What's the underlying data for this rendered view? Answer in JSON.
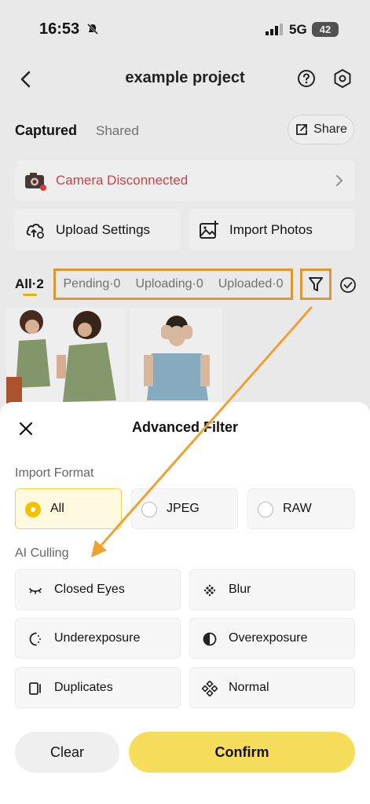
{
  "status_bar": {
    "time": "16:53",
    "network": "5G",
    "battery": "42"
  },
  "nav": {
    "title": "example project"
  },
  "tabs": {
    "captured": "Captured",
    "shared": "Shared",
    "share_button": "Share"
  },
  "camera": {
    "status": "Camera Disconnected"
  },
  "actions": {
    "upload_settings": "Upload Settings",
    "import_photos": "Import Photos"
  },
  "filter_row": {
    "all": "All·2",
    "pending": "Pending·0",
    "uploading": "Uploading·0",
    "uploaded": "Uploaded·0"
  },
  "sheet": {
    "title": "Advanced Filter",
    "import_format_label": "Import Format",
    "formats": [
      {
        "label": "All",
        "selected": true
      },
      {
        "label": "JPEG",
        "selected": false
      },
      {
        "label": "RAW",
        "selected": false
      }
    ],
    "ai_culling_label": "AI Culling",
    "ai_options": [
      {
        "label": "Closed Eyes",
        "icon": "closed-eyes-icon"
      },
      {
        "label": "Blur",
        "icon": "blur-icon"
      },
      {
        "label": "Underexposure",
        "icon": "underexposure-icon"
      },
      {
        "label": "Overexposure",
        "icon": "overexposure-icon"
      },
      {
        "label": "Duplicates",
        "icon": "duplicates-icon"
      },
      {
        "label": "Normal",
        "icon": "normal-icon"
      }
    ],
    "clear": "Clear",
    "confirm": "Confirm"
  },
  "colors": {
    "accent": "#f7dd5c",
    "selected_radio": "#f2c200",
    "annotation": "#f0a030",
    "error": "#c94b4b"
  }
}
